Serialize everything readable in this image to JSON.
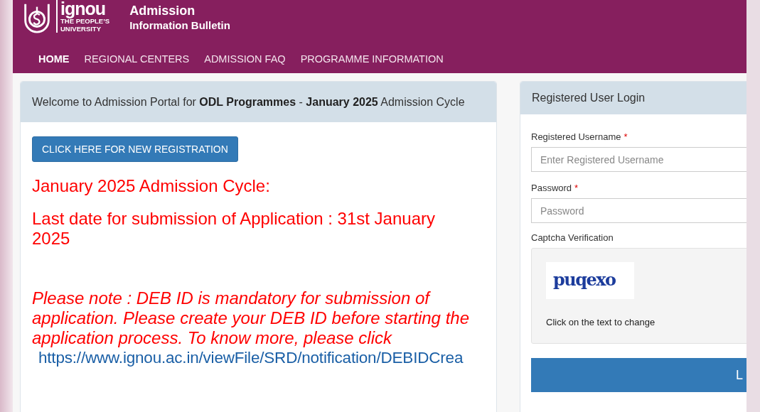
{
  "header": {
    "logo": {
      "wordmark": "ignou",
      "tagline": [
        "THE PEOPLE’S",
        "UNIVERSITY"
      ]
    },
    "title": "Admission",
    "subtitle": "Information Bulletin"
  },
  "nav": [
    {
      "label": "HOME",
      "selected": true
    },
    {
      "label": "REGIONAL CENTERS",
      "selected": false
    },
    {
      "label": "ADMISSION FAQ",
      "selected": false
    },
    {
      "label": "PROGRAMME INFORMATION",
      "selected": false
    }
  ],
  "welcome": {
    "heading": "Welcome to Admission Portal for **ODL Programmes** - **January 2025** Admission Cycle",
    "button": "CLICK HERE FOR NEW REGISTRATION",
    "notices": [
      "January 2025 Admission Cycle:",
      "Last date for submission of Application : 31st January 2025"
    ],
    "note": "Please note : DEB ID is mandatory for submission of application. Please create your DEB ID before starting the application process. To know more, please click",
    "link": "https://www.ignou.ac.in/viewFile/SRD/notification/DEBIDCrea"
  },
  "login": {
    "title": "Registered User Login",
    "fields": [
      {
        "label": "Registered Username",
        "required_mark": "*",
        "placeholder": "Enter Registered Username"
      },
      {
        "label": "Password",
        "required_mark": "*",
        "placeholder": "Password"
      }
    ],
    "captcha": {
      "label": "Captcha Verification",
      "code": "puqexo",
      "hint": "Click on the text to change"
    },
    "button": "L"
  }
}
